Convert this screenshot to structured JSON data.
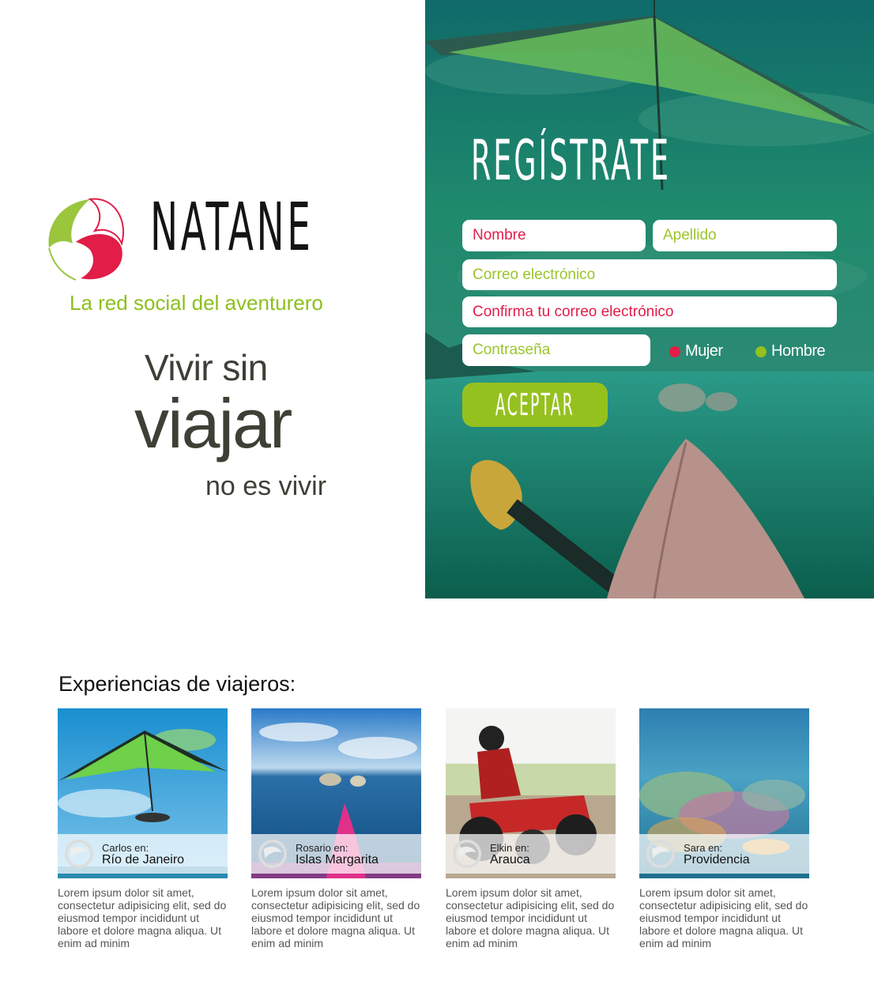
{
  "brand": {
    "name": "NATANE",
    "tagline": "La red social del aventurero"
  },
  "slogan": {
    "line1": "Vivir sin",
    "line2": "viajar",
    "line3": "no es vivir"
  },
  "register": {
    "title": "REGÍSTRATE",
    "fields": {
      "nombre": "Nombre",
      "apellido": "Apellido",
      "correo": "Correo electrónico",
      "confirma": "Confirma tu correo electrónico",
      "password": "Contraseña"
    },
    "gender": {
      "female": "Mujer",
      "male": "Hombre"
    },
    "submit": "ACEPTAR"
  },
  "experiences": {
    "title": "Experiencias de viajeros:",
    "cards": [
      {
        "who": "Carlos en:",
        "place": "Río de Janeiro",
        "icon": "hang-glider-photo",
        "text": "Lorem ipsum dolor sit amet, consectetur adipisicing elit, sed do eiusmod tempor incididunt ut labore et dolore magna aliqua. Ut enim ad minim"
      },
      {
        "who": "Rosario en:",
        "place": "Islas Margarita",
        "icon": "kayak-lake-photo",
        "text": "Lorem ipsum dolor sit amet, consectetur adipisicing elit, sed do eiusmod tempor incididunt ut labore et dolore magna aliqua. Ut enim ad minim"
      },
      {
        "who": "Elkin en:",
        "place": "Arauca",
        "icon": "quad-bike-photo",
        "text": "Lorem ipsum dolor sit amet, consectetur adipisicing elit, sed do eiusmod tempor incididunt ut labore et dolore magna aliqua. Ut enim ad minim"
      },
      {
        "who": "Sara en:",
        "place": "Providencia",
        "icon": "coral-reef-photo",
        "text": "Lorem ipsum dolor sit amet, consectetur adipisicing elit, sed do eiusmod tempor incididunt ut labore et dolore magna aliqua. Ut enim ad minim"
      }
    ]
  },
  "colors": {
    "accent_green": "#95c11f",
    "accent_red": "#e11d48",
    "text_dark": "#3f3f36",
    "panel_teal": "#1f7f6a"
  }
}
